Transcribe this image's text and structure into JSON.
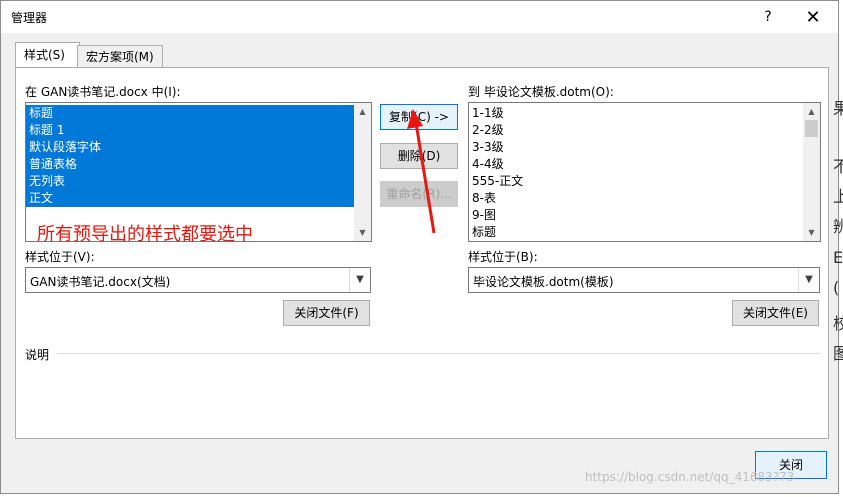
{
  "window": {
    "title": "管理器",
    "help": "?",
    "close": "✕"
  },
  "tabs": [
    {
      "label": "样式(S)"
    },
    {
      "label": "宏方案项(M)"
    }
  ],
  "left": {
    "label": "在 GAN读书笔记.docx 中(I):",
    "items": [
      "标题",
      "标题 1",
      "默认段落字体",
      "普通表格",
      "无列表",
      "正文"
    ],
    "location_label": "样式位于(V):",
    "location_value": "GAN读书笔记.docx(文档)",
    "close_file": "关闭文件(F)"
  },
  "right": {
    "label": "到 毕设论文模板.dotm(O):",
    "items": [
      "1-1级",
      "2-2级",
      "3-3级",
      "4-4级",
      "555-正文",
      "8-表",
      "9-图",
      "标题"
    ],
    "location_label": "样式位于(B):",
    "location_value": "毕设论文模板.dotm(模板)",
    "close_file": "关闭文件(E)"
  },
  "actions": {
    "copy": "复制(C) ->",
    "delete": "删除(D)",
    "rename": "重命名(R)..."
  },
  "annotation": "所有预导出的样式都要选中",
  "description_label": "说明",
  "footer": {
    "close": "关闭"
  },
  "background_chars": [
    "果",
    "不",
    "上",
    "辨",
    "E",
    "(",
    "校",
    "图"
  ],
  "watermark": "https://blog.csdn.net/qq_41683?73"
}
